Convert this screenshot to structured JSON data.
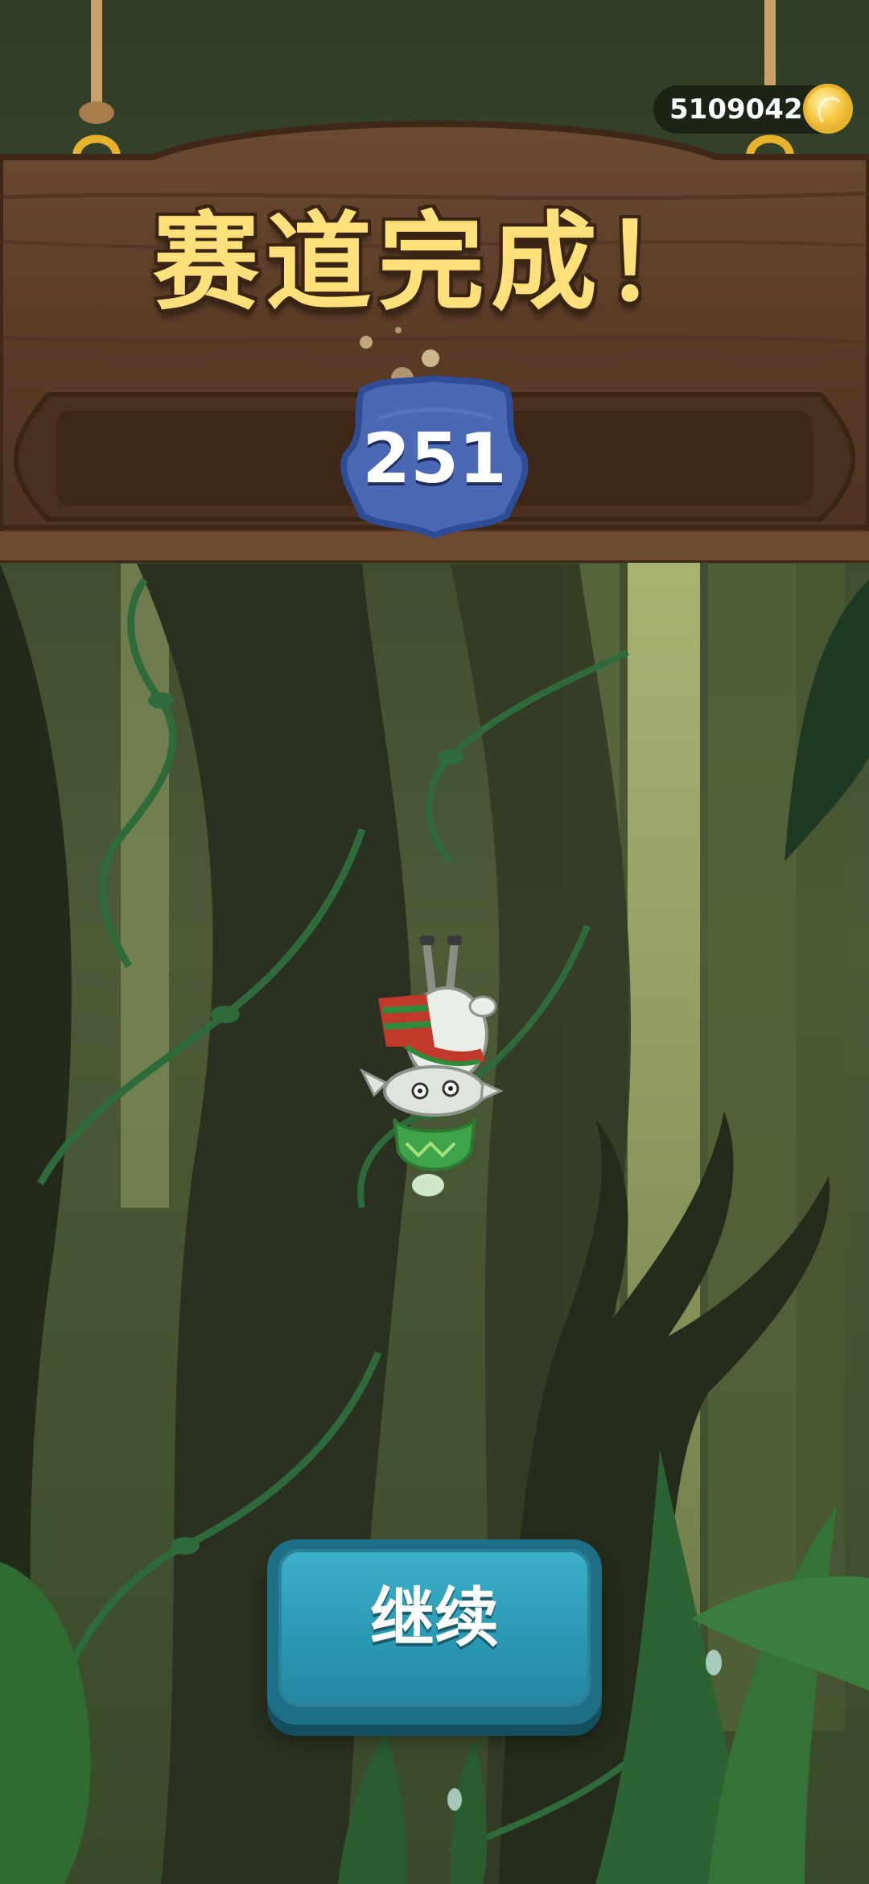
{
  "hud": {
    "coins": "5109042",
    "coin_icon": "gold-coin-icon"
  },
  "result_sign": {
    "title": "赛道完成！",
    "score": "251",
    "score_badge_icon": "blue-star-badge-icon"
  },
  "actions": {
    "continue_label": "继续"
  },
  "character": {
    "icon": "goat-with-scarf-falling-icon"
  },
  "colors": {
    "sign_wood": "#5a3b26",
    "sign_wood_dark": "#3f2818",
    "title_gold": "#ffe07a",
    "badge_blue": "#4a68b4",
    "button_teal": "#2a97b2",
    "jungle_dark": "#242a1a",
    "jungle_light": "#a6ad6a",
    "vine_green": "#2e6a3a"
  }
}
